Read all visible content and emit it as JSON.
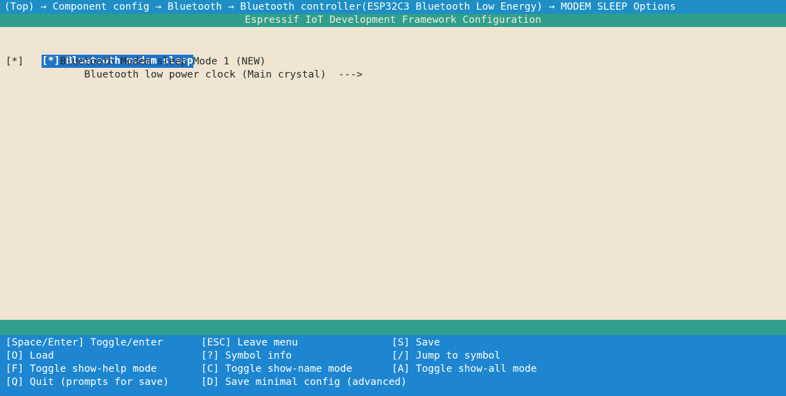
{
  "header": {
    "path": "(Top) → Component config → Bluetooth → Bluetooth controller(ESP32C3 Bluetooth Low Energy) → MODEM SLEEP Options",
    "title": "Espressif IoT Development Framework Configuration"
  },
  "menu": {
    "items": [
      {
        "prefix": "[*]",
        "label": "Bluetooth modem sleep",
        "selected": true
      },
      {
        "prefix": "[*]",
        "label": "Bluetooth Modem sleep Mode 1 (NEW)",
        "selected": false
      },
      {
        "prefix": "",
        "label": "Bluetooth low power clock (Main crystal)  --->",
        "selected": false
      }
    ]
  },
  "help": {
    "rows": [
      [
        "[Space/Enter] Toggle/enter",
        "[ESC] Leave menu",
        "[S] Save"
      ],
      [
        "[O] Load",
        "[?] Symbol info",
        "[/] Jump to symbol"
      ],
      [
        "[F] Toggle show-help mode",
        "[C] Toggle show-name mode",
        "[A] Toggle show-all mode"
      ],
      [
        "[Q] Quit (prompts for save)",
        "[D] Save minimal config (advanced)",
        ""
      ]
    ]
  }
}
